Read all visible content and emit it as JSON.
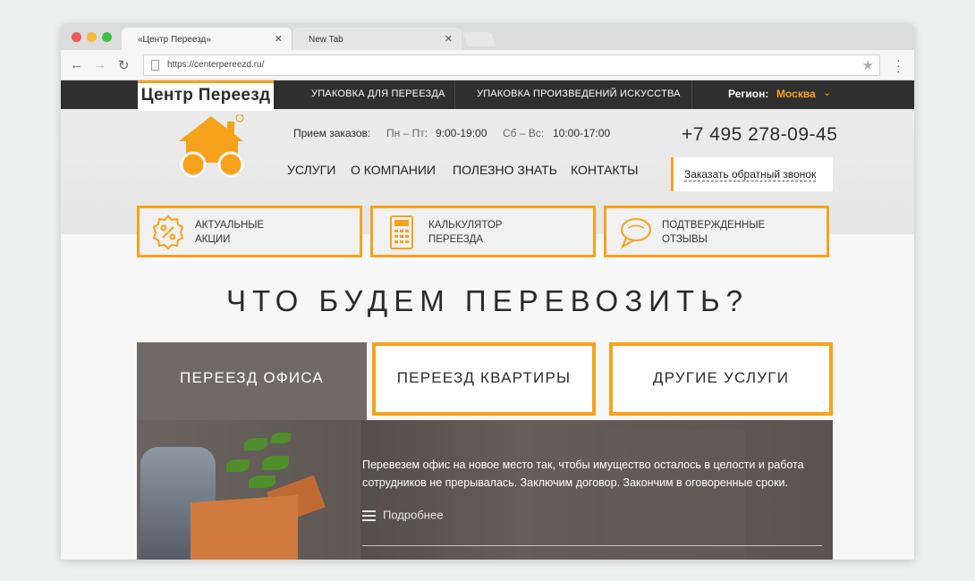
{
  "browser": {
    "tabs": [
      {
        "label": "«Центр Переезд»",
        "active": true
      },
      {
        "label": "New Tab",
        "active": false
      }
    ],
    "url": "https://centerpereezd.ru/"
  },
  "site": {
    "logo_text": "Центр Переезд",
    "topnav": {
      "links": [
        "УПАКОВКА ДЛЯ ПЕРЕЕЗДА",
        "УПАКОВКА ПРОИЗВЕДЕНИЙ ИСКУССТВА"
      ],
      "region_label": "Регион:",
      "region_value": "Москва"
    },
    "hours": {
      "label": "Прием заказов:",
      "weekday_label": "Пн – Пт:",
      "weekday_time": "9:00-19:00",
      "weekend_label": "Сб – Вс:",
      "weekend_time": "10:00-17:00"
    },
    "phone": "+7 495 278-09-45",
    "callback_label": "Заказать обратный звонок",
    "mainnav": [
      "УСЛУГИ",
      "О КОМПАНИИ",
      "ПОЛЕЗНО ЗНАТЬ",
      "КОНТАКТЫ"
    ],
    "features": [
      {
        "label": "АКТУАЛЬНЫЕ\nАКЦИИ",
        "icon": "percent-badge-icon"
      },
      {
        "label": "КАЛЬКУЛЯТОР\nПЕРЕЕЗДА",
        "icon": "calculator-icon"
      },
      {
        "label": "ПОДТВЕРЖДЕННЫЕ\nОТЗЫВЫ",
        "icon": "speech-bubble-icon"
      }
    ],
    "section_title": "ЧТО БУДЕМ ПЕРЕВОЗИТЬ?",
    "service_tabs": [
      {
        "label": "ПЕРЕЕЗД ОФИСА",
        "active": true
      },
      {
        "label": "ПЕРЕЕЗД КВАРТИРЫ",
        "active": false
      },
      {
        "label": "ДРУГИЕ УСЛУГИ",
        "active": false
      }
    ],
    "office": {
      "description": "Перевезем офис на новое место так, чтобы имущество осталось в целости и работа сотрудников не прерывалась. Заключим договор. Закончим в оговоренные сроки.",
      "more_label": "Подробнее"
    },
    "colors": {
      "accent": "#f7a21b",
      "dark": "#2f2f2f"
    }
  }
}
